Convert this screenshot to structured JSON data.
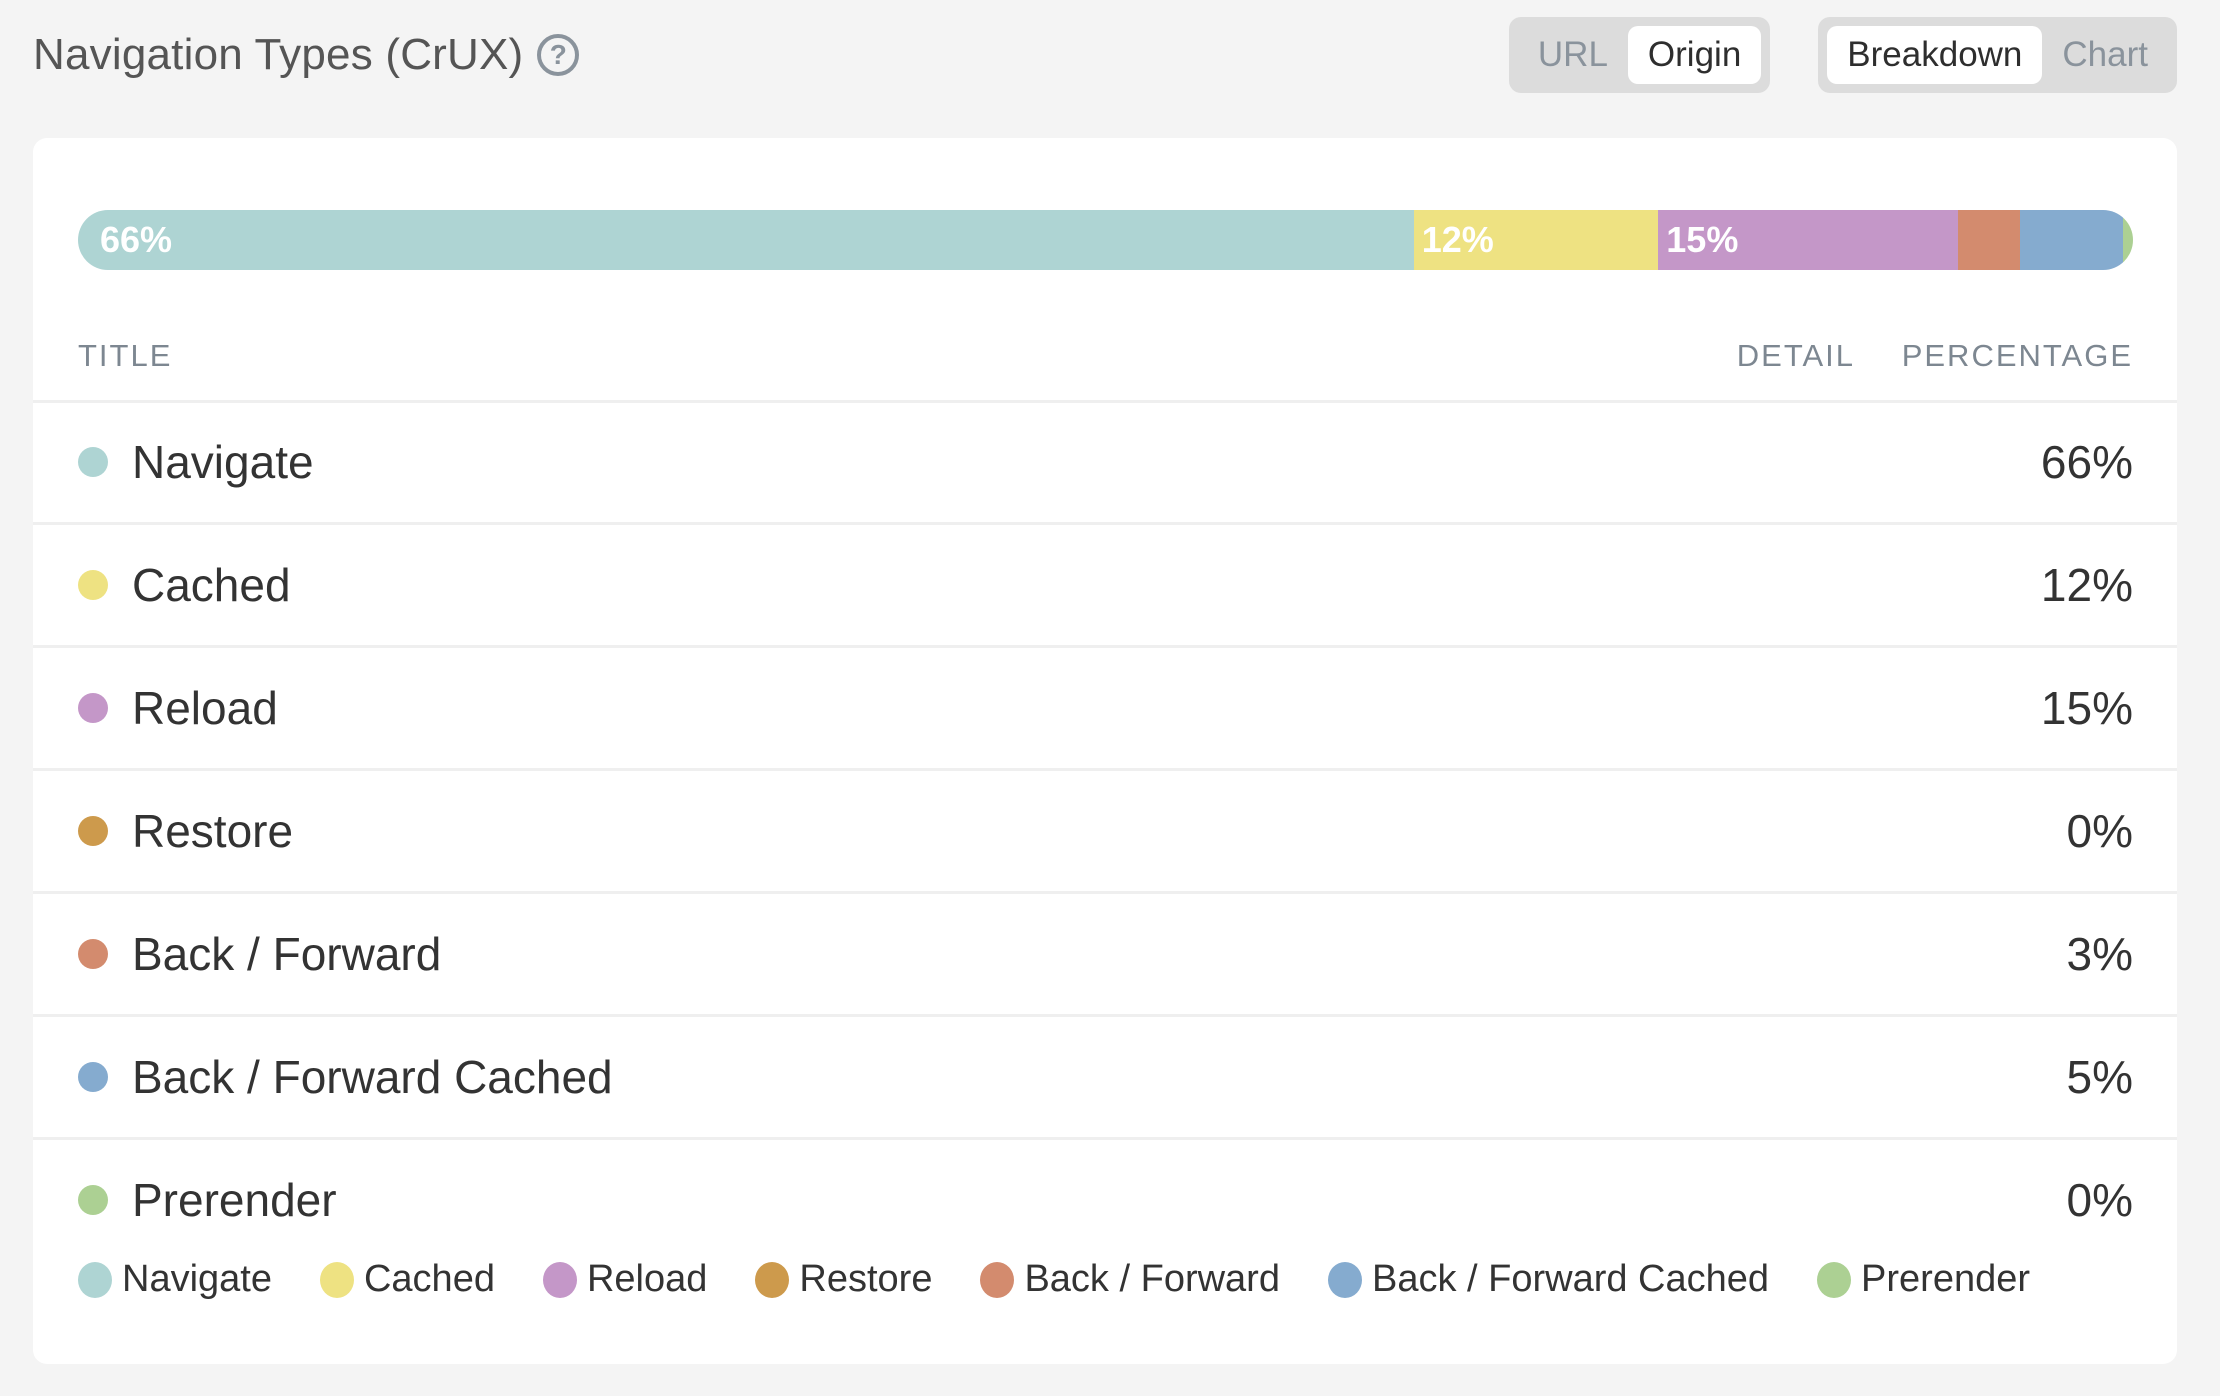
{
  "header": {
    "title": "Navigation Types (CrUX)",
    "help_icon": "?",
    "scope_toggle": [
      {
        "label": "URL",
        "active": false
      },
      {
        "label": "Origin",
        "active": true
      }
    ],
    "view_toggle": [
      {
        "label": "Breakdown",
        "active": true
      },
      {
        "label": "Chart",
        "active": false
      }
    ]
  },
  "table": {
    "columns": {
      "title": "TITLE",
      "detail": "DETAIL",
      "percentage": "PERCENTAGE"
    },
    "rows": [
      {
        "label": "Navigate",
        "percentage": "66%",
        "color": "#aed4d3"
      },
      {
        "label": "Cached",
        "percentage": "12%",
        "color": "#eee282"
      },
      {
        "label": "Reload",
        "percentage": "15%",
        "color": "#c497c8"
      },
      {
        "label": "Restore",
        "percentage": "0%",
        "color": "#cd9a4c"
      },
      {
        "label": "Back / Forward",
        "percentage": "3%",
        "color": "#d38b6e"
      },
      {
        "label": "Back / Forward Cached",
        "percentage": "5%",
        "color": "#85abcf"
      },
      {
        "label": "Prerender",
        "percentage": "0%",
        "color": "#acd093"
      }
    ]
  },
  "chart_data": {
    "type": "bar",
    "orientation": "horizontal-stacked",
    "categories": [
      "Navigate",
      "Cached",
      "Reload",
      "Restore",
      "Back / Forward",
      "Back / Forward Cached",
      "Prerender"
    ],
    "values": [
      65,
      11.9,
      14.6,
      0,
      3,
      5,
      0.5
    ],
    "labels": [
      "66%",
      "12%",
      "15%",
      "",
      "",
      "",
      ""
    ],
    "colors": [
      "#aed4d3",
      "#eee282",
      "#c497c8",
      "#cd9a4c",
      "#d38b6e",
      "#85abcf",
      "#acd093"
    ],
    "legend": [
      "Navigate",
      "Cached",
      "Reload",
      "Restore",
      "Back / Forward",
      "Back / Forward Cached",
      "Prerender"
    ],
    "legend_position": "bottom",
    "title": "Navigation Types (CrUX)"
  }
}
